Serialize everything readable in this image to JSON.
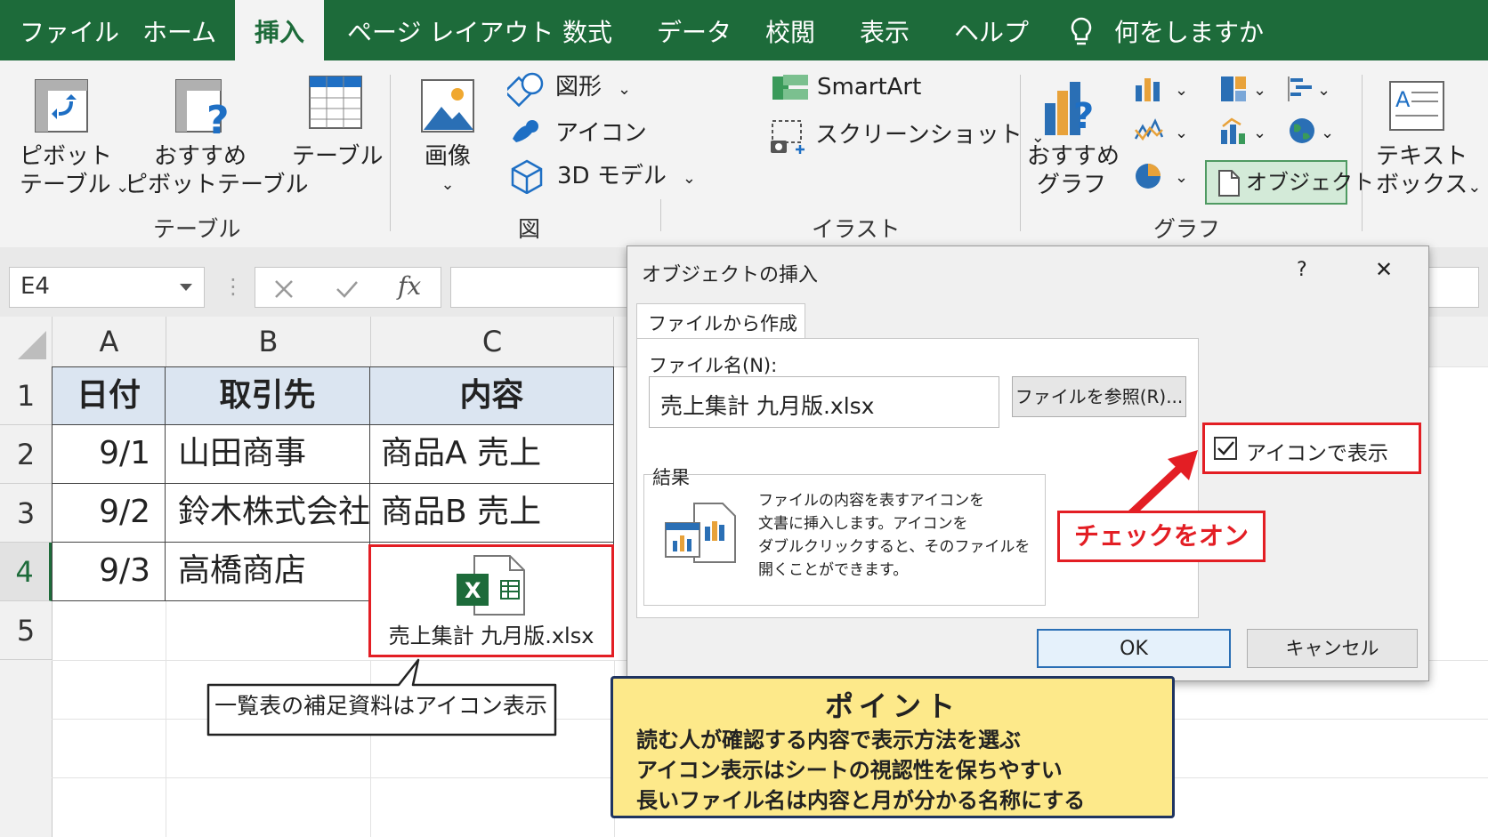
{
  "tabs": [
    "ファイル",
    "ホーム",
    "挿入",
    "ページ レイアウト",
    "数式",
    "データ",
    "校閲",
    "表示",
    "ヘルプ"
  ],
  "tell_me": "何をしますか",
  "ribbon": {
    "pivot_table": [
      "ピボット",
      "テーブル"
    ],
    "recommended_pivot": [
      "おすすめ",
      "ピボットテーブル"
    ],
    "table": "テーブル",
    "group_table": "テーブル",
    "image": "画像",
    "shapes": "図形",
    "icons": "アイコン",
    "model3d": "3D モデル",
    "group_figure": "図",
    "smartart": "SmartArt",
    "screenshot": "スクリーンショット",
    "group_illust": "イラスト",
    "recommended_chart": [
      "おすすめ",
      "グラフ"
    ],
    "object": "オブジェクト",
    "group_chart": "グラフ",
    "textbox": [
      "テキスト",
      "ボックス"
    ],
    "dropdown_glyph": "⌄"
  },
  "formula_bar": {
    "name_box": "E4",
    "fx": "fx"
  },
  "columns": [
    "A",
    "B",
    "C"
  ],
  "rows": [
    "1",
    "2",
    "3",
    "4",
    "5"
  ],
  "table": {
    "headers": [
      "日付",
      "取引先",
      "内容"
    ],
    "data": [
      [
        "9/1",
        "山田商事",
        "商品A 売上"
      ],
      [
        "9/2",
        "鈴木株式会社",
        "商品B 売上"
      ],
      [
        "9/3",
        "高橋商店",
        ""
      ]
    ]
  },
  "embedded_icon": {
    "filename": "売上集計 九月版.xlsx",
    "badge": "X"
  },
  "callout_left": "一覧表の補足資料はアイコン表示",
  "dialog": {
    "title": "オブジェクトの挿入",
    "help": "?",
    "close": "✕",
    "tab": "ファイルから作成",
    "filename_label": "ファイル名(N):",
    "filename_value": "売上集計 九月版.xlsx",
    "browse": "ファイルを参照(R)...",
    "display_as_icon": "アイコンで表示",
    "result_label": "結果",
    "result_text": [
      "ファイルの内容を表すアイコンを",
      "文書に挿入します。アイコンを",
      "ダブルクリックすると、そのファイルを",
      "開くことができます。"
    ],
    "ok": "OK",
    "cancel": "キャンセル"
  },
  "annotation_check": "チェックをオン",
  "point": {
    "title": "ポイント",
    "lines": [
      "読む人が確認する内容で表示方法を選ぶ",
      "アイコン表示はシートの視認性を保ちやすい",
      "長いファイル名は内容と月が分かる名称にする"
    ]
  },
  "colors": {
    "excel_green": "#1d6b3a",
    "highlight_red": "#e31e24",
    "point_bg": "#fde98a",
    "point_border": "#1f3460",
    "header_fill": "#dbe5f1"
  }
}
